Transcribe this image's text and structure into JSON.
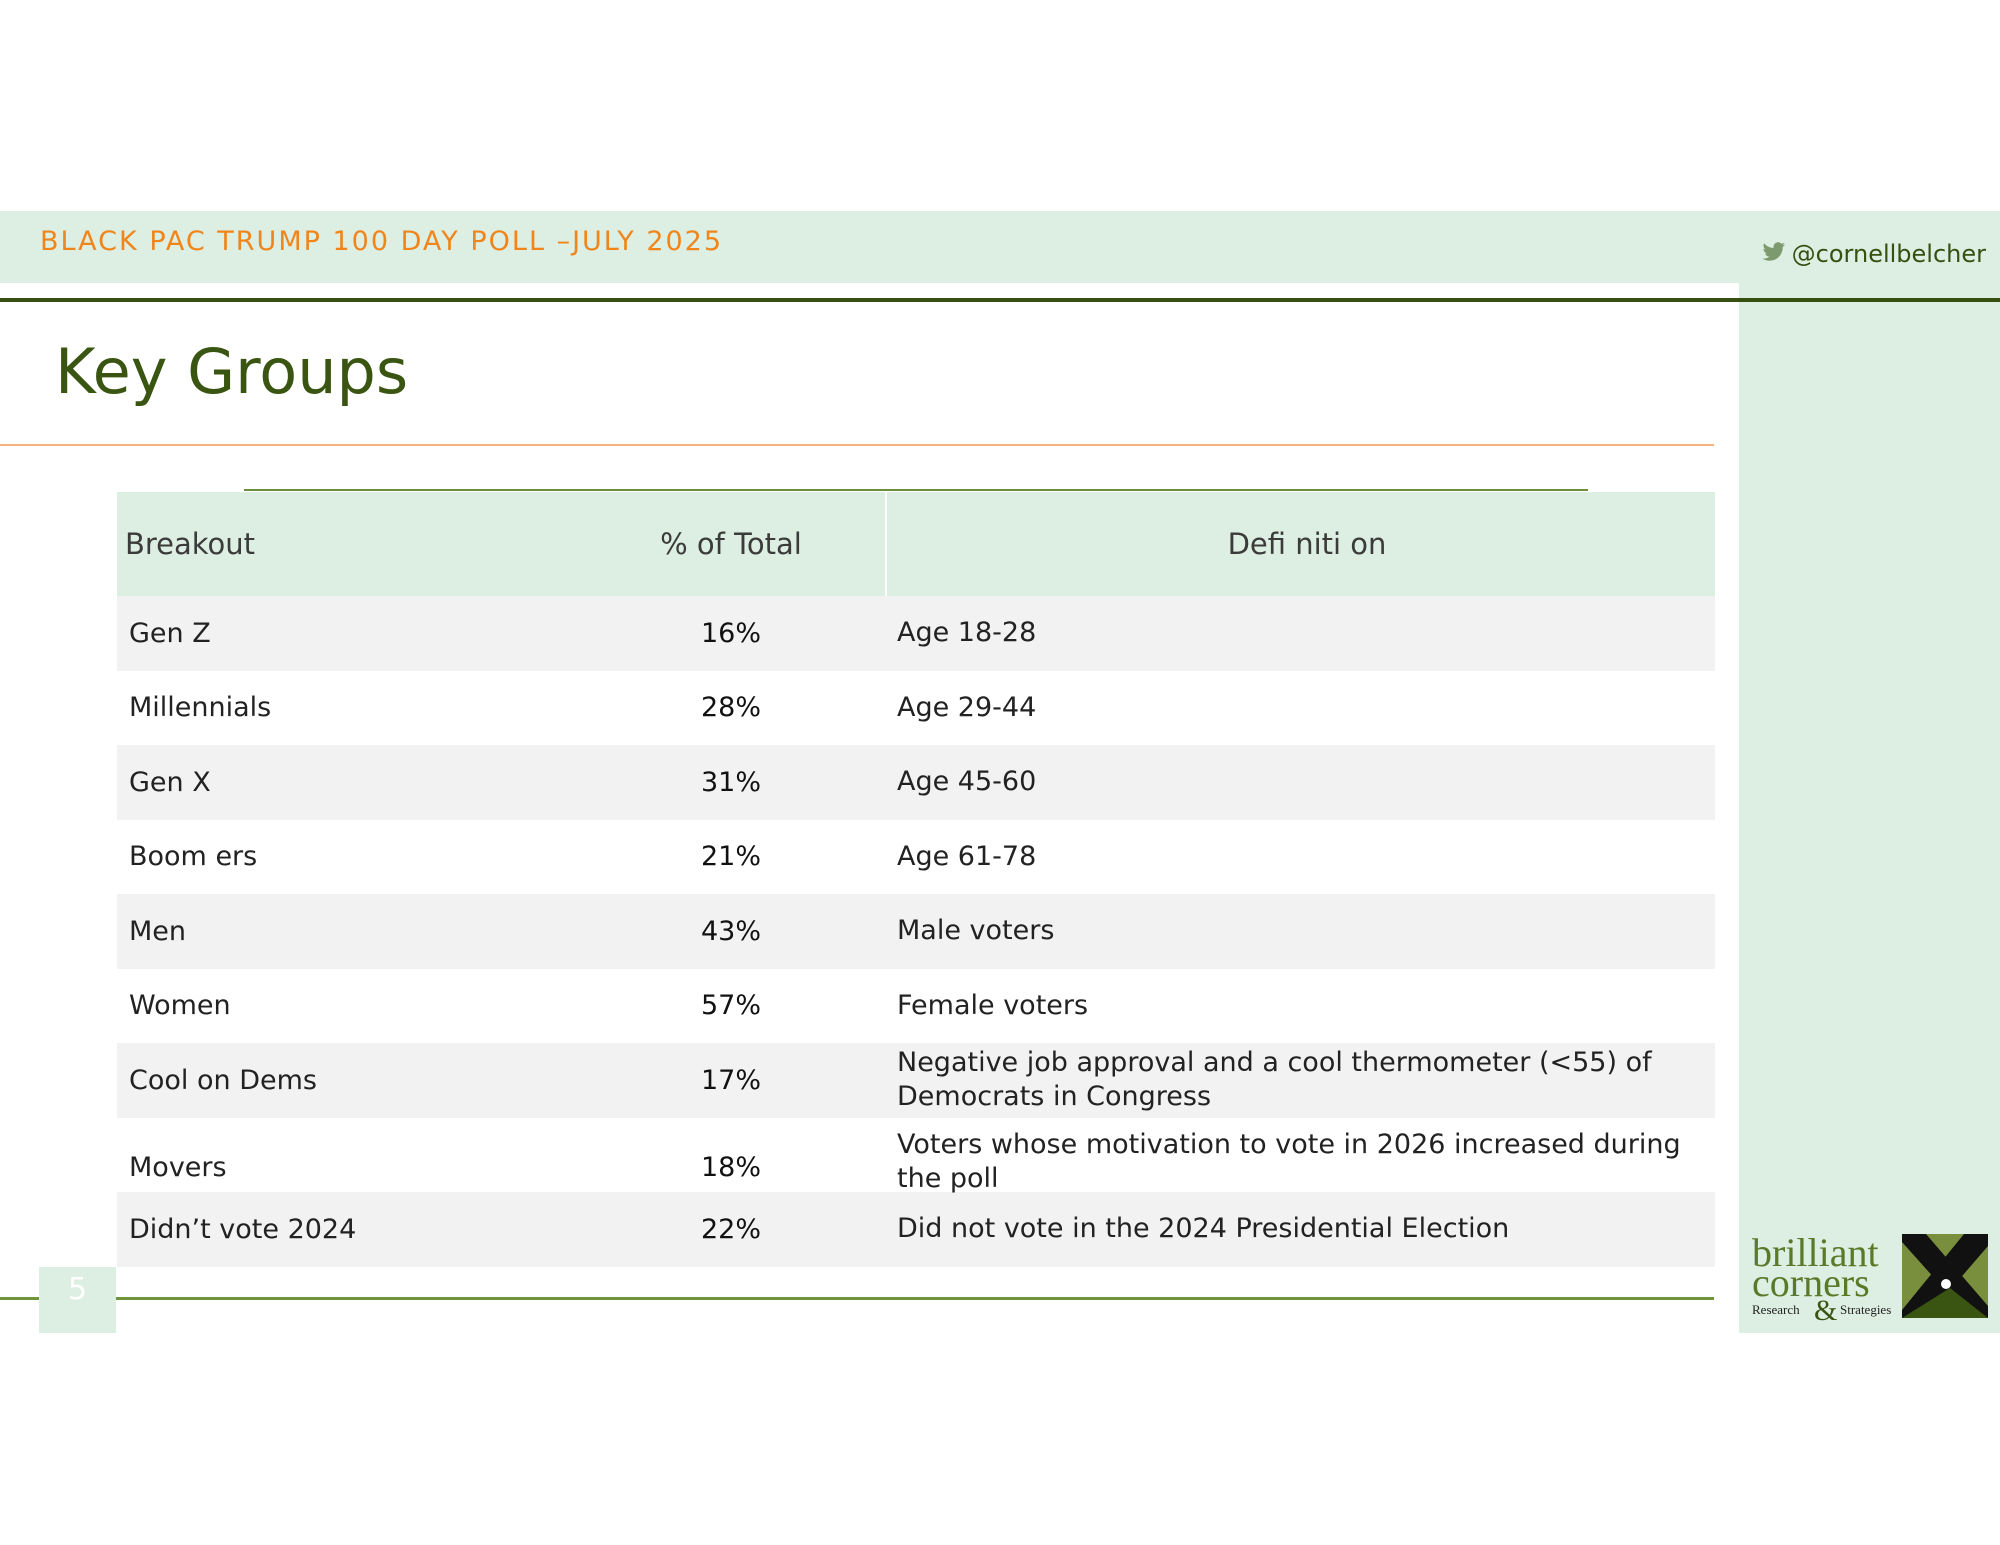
{
  "header": {
    "title": "BLACK PAC TRUMP 100 DAY POLL –JULY 2025",
    "handle": "@cornellbelcher",
    "handle_icon": "twitter-bird-icon"
  },
  "page_title": "Key Groups",
  "table": {
    "columns": [
      "Breakout",
      "% of Total",
      "Defi niti on"
    ],
    "rows": [
      {
        "breakout": "Gen Z",
        "pct": "16%",
        "definition": "Age 18-28"
      },
      {
        "breakout": "Millennials",
        "pct": "28%",
        "definition": "Age 29-44"
      },
      {
        "breakout": "Gen X",
        "pct": "31%",
        "definition": "Age 45-60"
      },
      {
        "breakout": "Boom ers",
        "pct": "21%",
        "definition": "Age 61-78"
      },
      {
        "breakout": "Men",
        "pct": "43%",
        "definition": "Male voters"
      },
      {
        "breakout": "Women",
        "pct": "57%",
        "definition": "Female voters"
      },
      {
        "breakout": "Cool on Dems",
        "pct": "17%",
        "definition": "Negative job approval and a cool thermometer (<55) of Democrats in Congress"
      },
      {
        "breakout": "Movers",
        "pct": "18%",
        "definition": "Voters whose motivation to vote in 2026 increased during the poll"
      },
      {
        "breakout": "Didn’t vote 2024",
        "pct": "22%",
        "definition": "Did not vote in the 2024 Presidential Election"
      }
    ]
  },
  "page_number": "5",
  "logo": {
    "line1": "brilliant",
    "line2": "corners",
    "left_word": "Research",
    "ampersand": "&",
    "right_word": "Strategies"
  },
  "colors": {
    "accent_orange": "#f0861b",
    "dark_green": "#375011",
    "light_green": "#ddeee2",
    "olive": "#7a8f3e"
  }
}
